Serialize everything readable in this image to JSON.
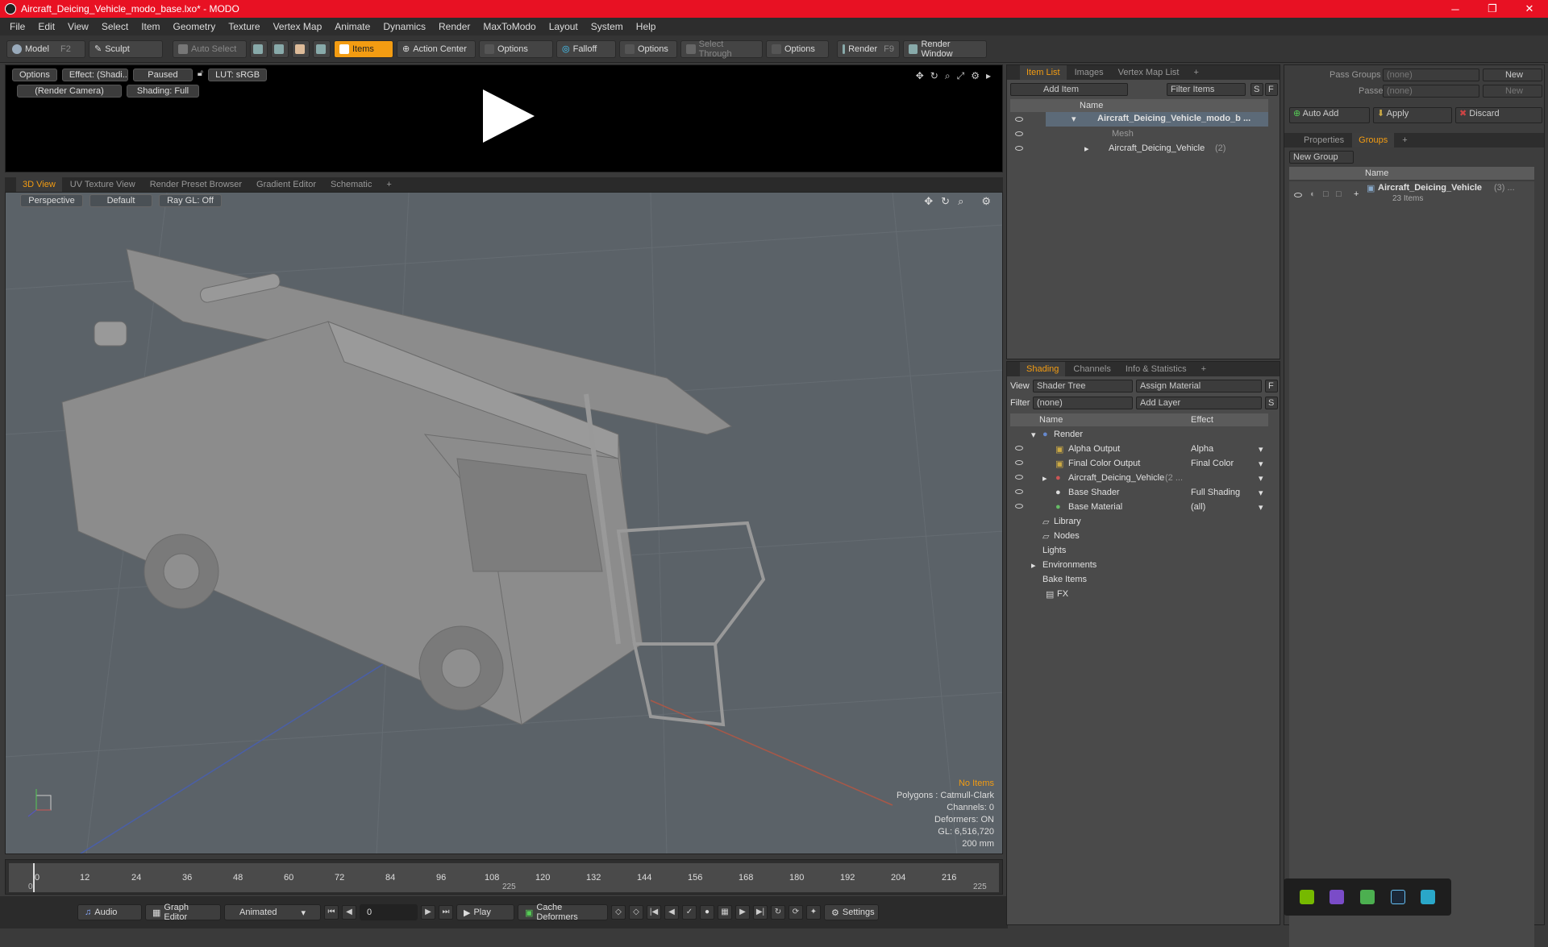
{
  "window": {
    "title": "Aircraft_Deicing_Vehicle_modo_base.lxo* - MODO",
    "minimize": "─",
    "maximize": "❐",
    "close": "✕"
  },
  "menu": [
    "File",
    "Edit",
    "View",
    "Select",
    "Item",
    "Geometry",
    "Texture",
    "Vertex Map",
    "Animate",
    "Dynamics",
    "Render",
    "MaxToModo",
    "Layout",
    "System",
    "Help"
  ],
  "toolbar": {
    "model": "Model",
    "model_key": "F2",
    "sculpt": "Sculpt",
    "auto_select": "Auto Select",
    "items": "Items",
    "action_center": "Action Center",
    "options1": "Options",
    "falloff": "Falloff",
    "options2": "Options",
    "select_through": "Select Through",
    "options3": "Options",
    "render": "Render",
    "render_key": "F9",
    "render_window": "Render Window"
  },
  "render_panel": {
    "options": "Options",
    "effect": "Effect: (Shadi...",
    "paused": "Paused",
    "lut": "LUT: sRGB",
    "camera": "(Render Camera)",
    "shading": "Shading: Full"
  },
  "view_tabs": [
    "3D View",
    "UV Texture View",
    "Render Preset Browser",
    "Gradient Editor",
    "Schematic",
    "+"
  ],
  "viewport": {
    "perspective": "Perspective",
    "default": "Default",
    "raygl": "Ray GL: Off"
  },
  "stats": {
    "no_items": "No Items",
    "polygons": "Polygons : Catmull-Clark",
    "channels": "Channels: 0",
    "deformers": "Deformers: ON",
    "gl": "GL: 6,516,720",
    "unit": "200 mm"
  },
  "timeline": {
    "ticks": [
      "0",
      "12",
      "24",
      "36",
      "48",
      "60",
      "72",
      "84",
      "96",
      "108",
      "120",
      "132",
      "144",
      "156",
      "168",
      "180",
      "192",
      "204",
      "216"
    ],
    "start": "0",
    "mid": "225",
    "end": "225"
  },
  "bottom": {
    "audio": "Audio",
    "graph_editor": "Graph Editor",
    "animated": "Animated",
    "frame": "0",
    "play": "Play",
    "cache": "Cache Deformers",
    "settings": "Settings"
  },
  "item_list": {
    "tabs": [
      "Item List",
      "Images",
      "Vertex Map List",
      "+"
    ],
    "add_item": "Add Item",
    "filter": "Filter Items",
    "s": "S",
    "f": "F",
    "col_name": "Name",
    "rows": [
      {
        "label": "Aircraft_Deicing_Vehicle_modo_b ...",
        "bold": true
      },
      {
        "label": "Mesh"
      },
      {
        "label": "Aircraft_Deicing_Vehicle",
        "count": "(2)"
      }
    ]
  },
  "shading": {
    "tabs": [
      "Shading",
      "Channels",
      "Info & Statistics",
      "+"
    ],
    "view_label": "View",
    "view_value": "Shader Tree",
    "assign": "Assign Material",
    "filter_label": "Filter",
    "filter_value": "(none)",
    "add_layer": "Add Layer",
    "f": "F",
    "s": "S",
    "col_name": "Name",
    "col_effect": "Effect",
    "rows": [
      {
        "label": "Render",
        "effect": ""
      },
      {
        "label": "Alpha Output",
        "effect": "Alpha"
      },
      {
        "label": "Final Color Output",
        "effect": "Final Color"
      },
      {
        "label": "Aircraft_Deicing_Vehicle",
        "suffix": "(2 ...",
        "effect": ""
      },
      {
        "label": "Base Shader",
        "effect": "Full Shading"
      },
      {
        "label": "Base Material",
        "effect": "(all)"
      },
      {
        "label": "Library",
        "effect": ""
      },
      {
        "label": "Nodes",
        "effect": ""
      },
      {
        "label": "Lights",
        "effect": ""
      },
      {
        "label": "Environments",
        "effect": ""
      },
      {
        "label": "Bake Items",
        "effect": ""
      },
      {
        "label": "FX",
        "effect": ""
      }
    ]
  },
  "groups": {
    "pass_groups": "Pass Groups",
    "passes": "Passes",
    "none1": "(none)",
    "none2": "(none)",
    "new1": "New",
    "new2": "New",
    "auto_add": "Auto Add",
    "apply": "Apply",
    "discard": "Discard",
    "tabs": [
      "Properties",
      "Groups",
      "+"
    ],
    "new_group": "New Group",
    "col_name": "Name",
    "group_name": "Aircraft_Deicing_Vehicle",
    "group_count": "(3) ...",
    "group_items": "23 Items"
  },
  "colors": {
    "accent": "#f39c12",
    "titlebar": "#e81123"
  }
}
